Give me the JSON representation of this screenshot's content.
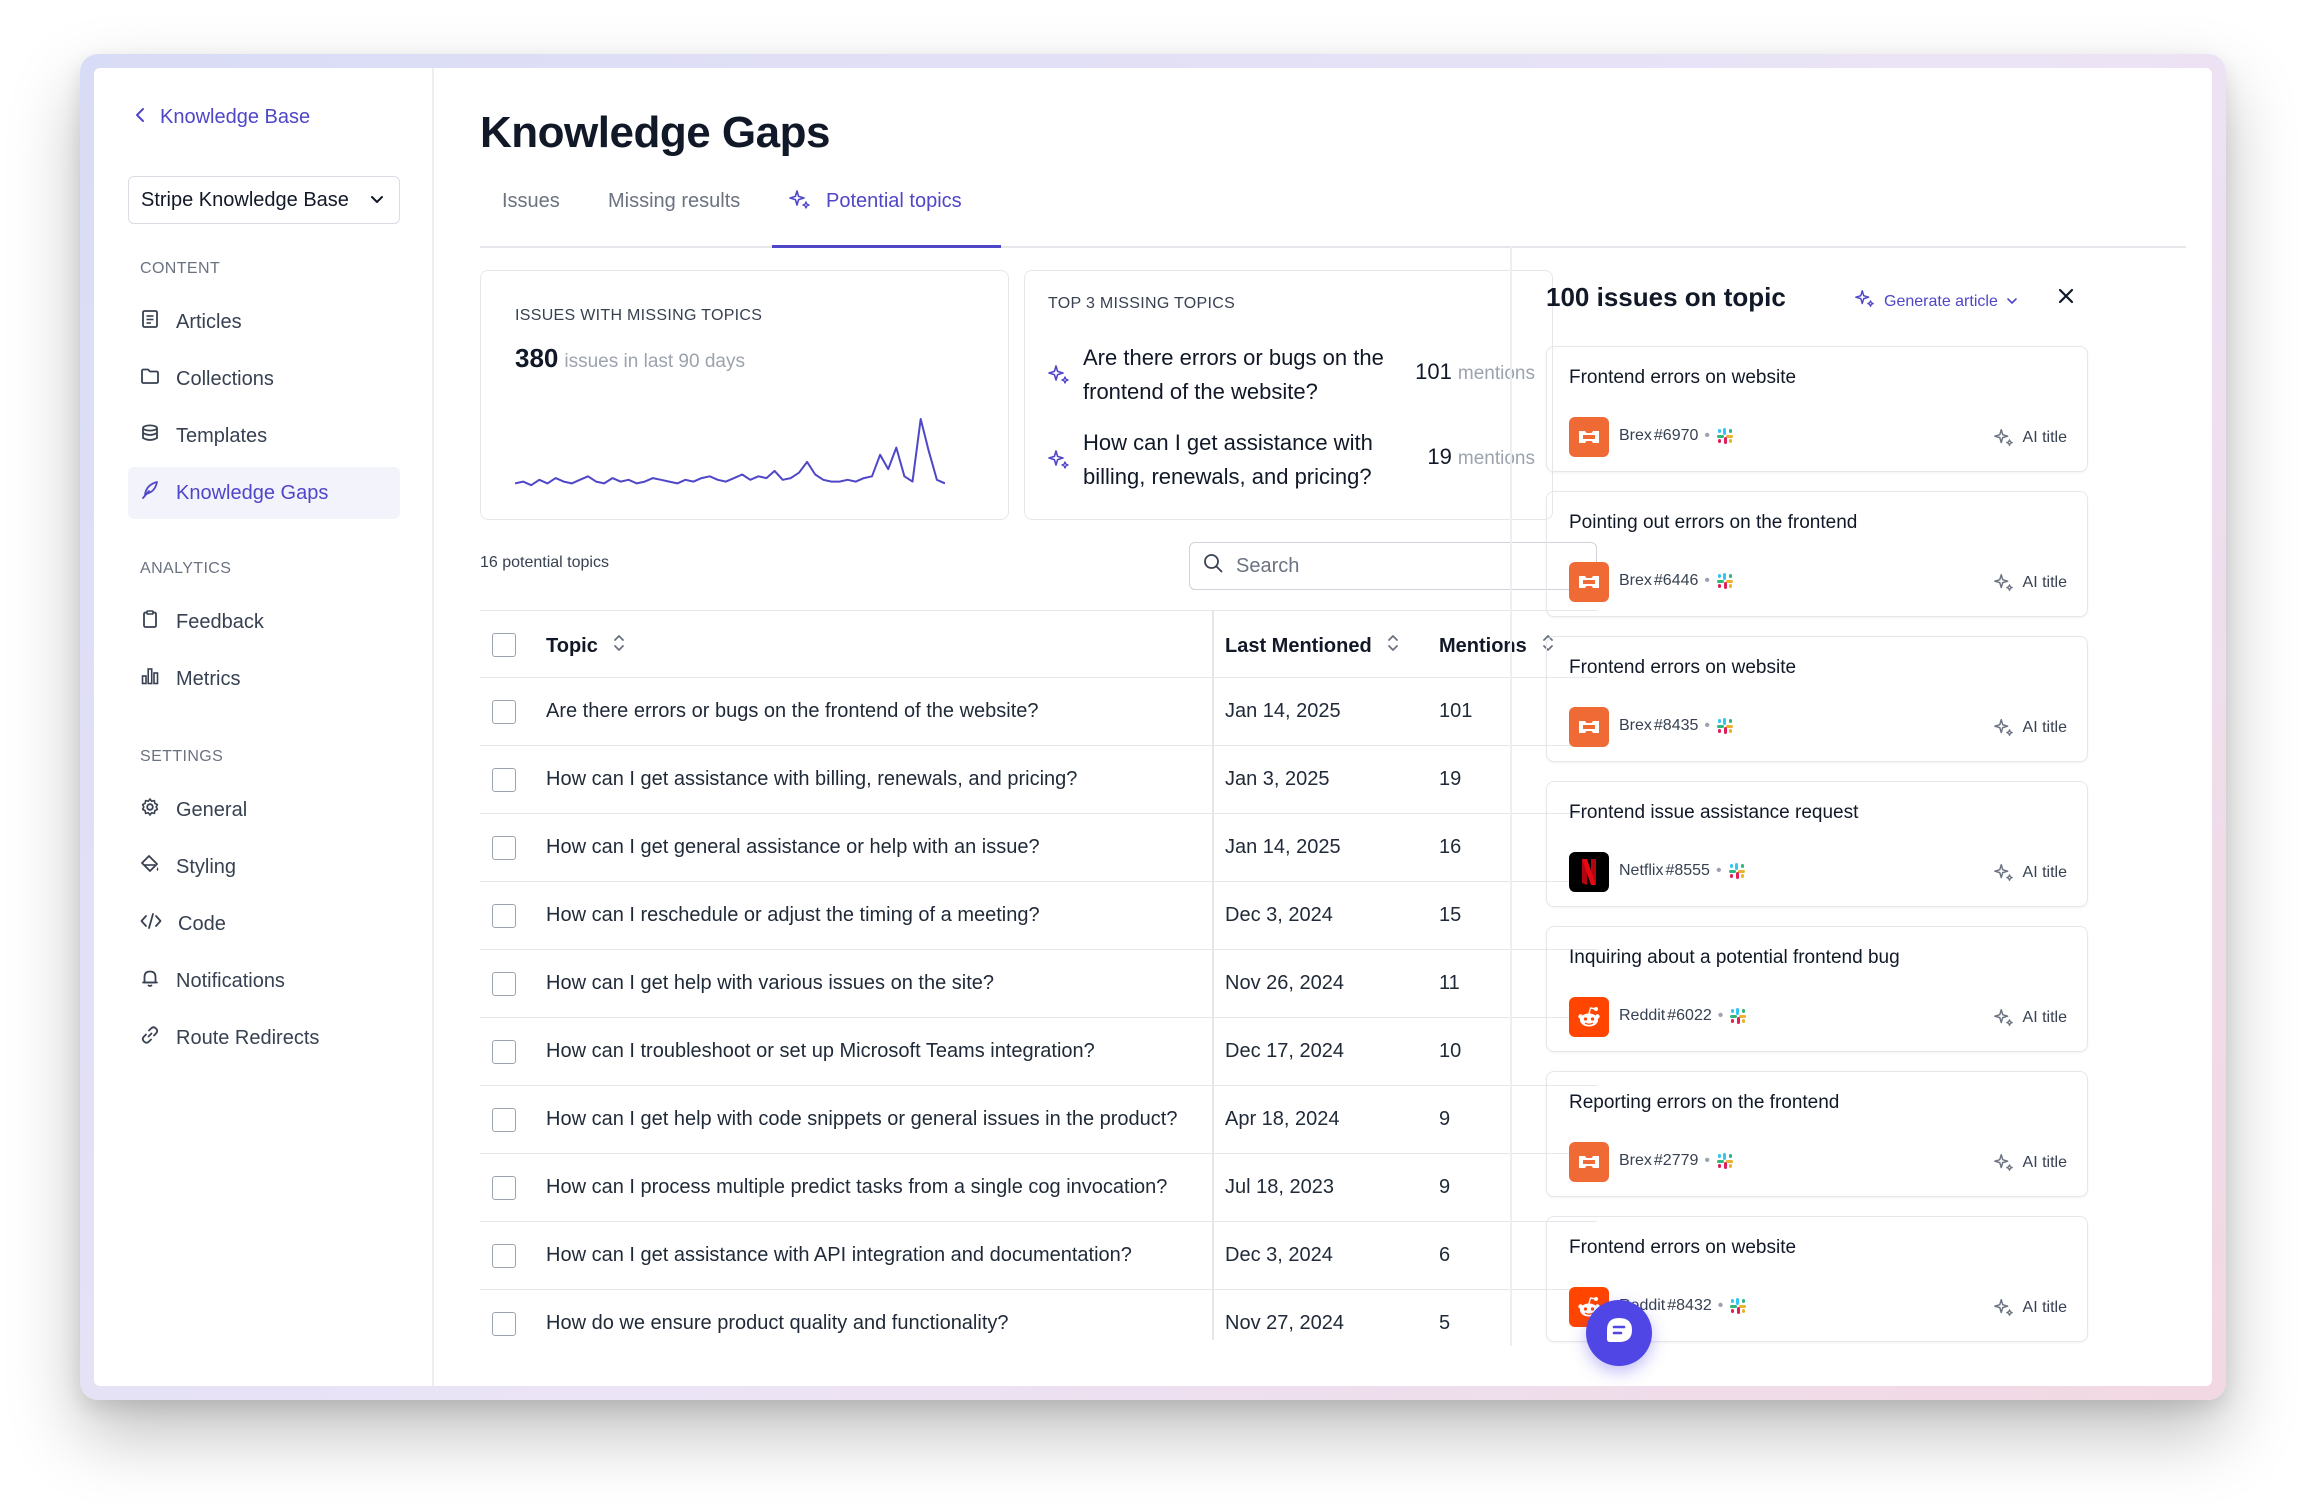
{
  "sidebar": {
    "back_label": "Knowledge Base",
    "kb_select": "Stripe Knowledge Base",
    "sections": [
      {
        "label": "CONTENT",
        "items": [
          {
            "label": "Articles",
            "icon": "document-icon"
          },
          {
            "label": "Collections",
            "icon": "folder-icon"
          },
          {
            "label": "Templates",
            "icon": "database-icon"
          },
          {
            "label": "Knowledge Gaps",
            "icon": "quill-icon",
            "active": true
          }
        ]
      },
      {
        "label": "ANALYTICS",
        "items": [
          {
            "label": "Feedback",
            "icon": "clipboard-icon"
          },
          {
            "label": "Metrics",
            "icon": "bar-chart-icon"
          }
        ]
      },
      {
        "label": "SETTINGS",
        "items": [
          {
            "label": "General",
            "icon": "gear-icon"
          },
          {
            "label": "Styling",
            "icon": "paint-icon"
          },
          {
            "label": "Code",
            "icon": "code-icon"
          },
          {
            "label": "Notifications",
            "icon": "bell-icon"
          },
          {
            "label": "Route Redirects",
            "icon": "link-icon"
          }
        ]
      }
    ]
  },
  "main": {
    "title": "Knowledge Gaps",
    "tabs": [
      {
        "label": "Issues"
      },
      {
        "label": "Missing results"
      },
      {
        "label": "Potential topics",
        "active": true
      }
    ],
    "stats_card": {
      "label": "ISSUES WITH MISSING TOPICS",
      "value": "380",
      "suffix": "issues in last 90 days",
      "sparkline": [
        2,
        3,
        1,
        4,
        2,
        5,
        3,
        2,
        4,
        6,
        3,
        2,
        5,
        3,
        4,
        2,
        3,
        5,
        4,
        3,
        2,
        4,
        3,
        5,
        6,
        4,
        3,
        5,
        7,
        4,
        6,
        5,
        9,
        4,
        5,
        8,
        14,
        7,
        4,
        3,
        3,
        4,
        3,
        5,
        6,
        18,
        10,
        22,
        6,
        3,
        38,
        20,
        4,
        2
      ]
    },
    "top_card": {
      "label": "TOP 3 MISSING TOPICS",
      "items": [
        {
          "question": "Are there errors or bugs on the frontend of the website?",
          "count": "101",
          "unit": "mentions"
        },
        {
          "question": "How can I get assistance with billing, renewals, and pricing?",
          "count": "19",
          "unit": "mentions"
        }
      ]
    },
    "topics_count": "16 potential topics",
    "search_placeholder": "Search",
    "table": {
      "headers": {
        "topic": "Topic",
        "last": "Last Mentioned",
        "mentions": "Mentions"
      },
      "rows": [
        {
          "topic": "Are there errors or bugs on the frontend of the website?",
          "last": "Jan 14, 2025",
          "mentions": "101"
        },
        {
          "topic": "How can I get assistance with billing, renewals, and pricing?",
          "last": "Jan 3, 2025",
          "mentions": "19"
        },
        {
          "topic": "How can I get general assistance or help with an issue?",
          "last": "Jan 14, 2025",
          "mentions": "16"
        },
        {
          "topic": "How can I reschedule or adjust the timing of a meeting?",
          "last": "Dec 3, 2024",
          "mentions": "15"
        },
        {
          "topic": "How can I get help with various issues on the site?",
          "last": "Nov 26, 2024",
          "mentions": "11"
        },
        {
          "topic": "How can I troubleshoot or set up Microsoft Teams integration?",
          "last": "Dec 17, 2024",
          "mentions": "10"
        },
        {
          "topic": "How can I get help with code snippets or general issues in the product?",
          "last": "Apr 18, 2024",
          "mentions": "9"
        },
        {
          "topic": "How can I process multiple predict tasks from a single cog invocation?",
          "last": "Jul 18, 2023",
          "mentions": "9"
        },
        {
          "topic": "How can I get assistance with API integration and documentation?",
          "last": "Dec 3, 2024",
          "mentions": "6"
        },
        {
          "topic": "How do we ensure product quality and functionality?",
          "last": "Nov 27, 2024",
          "mentions": "5"
        }
      ]
    }
  },
  "panel": {
    "title": "100 issues on topic",
    "generate_label": "Generate article",
    "ai_label": "AI title",
    "issues": [
      {
        "title": "Frontend errors on website",
        "source": "Brex",
        "id": "#6970",
        "logo": "brex"
      },
      {
        "title": "Pointing out errors on the frontend",
        "source": "Brex",
        "id": "#6446",
        "logo": "brex"
      },
      {
        "title": "Frontend errors on website",
        "source": "Brex",
        "id": "#8435",
        "logo": "brex"
      },
      {
        "title": "Frontend issue assistance request",
        "source": "Netflix",
        "id": "#8555",
        "logo": "netflix"
      },
      {
        "title": "Inquiring about a potential frontend bug",
        "source": "Reddit",
        "id": "#6022",
        "logo": "reddit"
      },
      {
        "title": "Reporting errors on the frontend",
        "source": "Brex",
        "id": "#2779",
        "logo": "brex"
      },
      {
        "title": "Frontend errors on website",
        "source": "Reddit",
        "id": "#8432",
        "logo": "reddit"
      }
    ]
  },
  "colors": {
    "accent": "#4f46c8",
    "brex": "#f06a35",
    "netflix": "#e50914",
    "reddit": "#ff4500",
    "chat": "#4f46e5"
  }
}
